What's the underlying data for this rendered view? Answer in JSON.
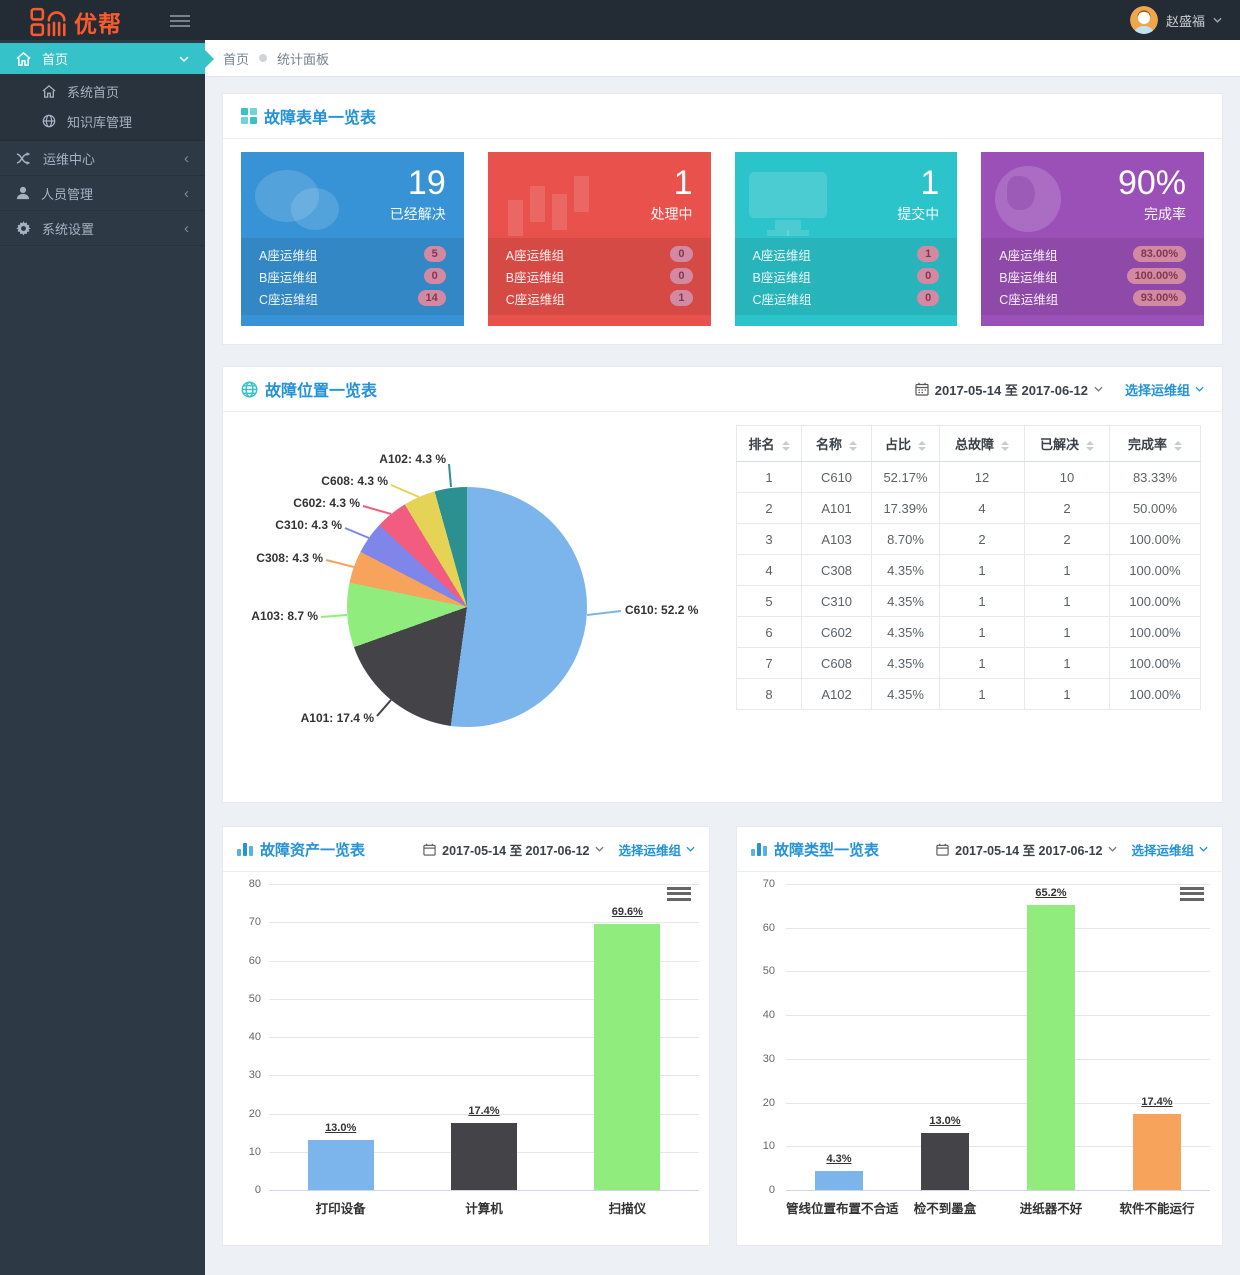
{
  "navbar": {
    "brand": "优帮",
    "user_name": "赵盛福"
  },
  "sidebar": {
    "items": [
      {
        "label": "首页"
      },
      {
        "label": "系统首页"
      },
      {
        "label": "知识库管理"
      },
      {
        "label": "运维中心"
      },
      {
        "label": "人员管理"
      },
      {
        "label": "系统设置"
      }
    ]
  },
  "breadcrumb": {
    "items": [
      "首页",
      "统计面板"
    ]
  },
  "colors": {
    "accent_teal": "#35c2c9",
    "title_blue": "#2492d6",
    "card_blue": "#3793d5",
    "card_red": "#e9514d",
    "card_teal": "#2cc4cb",
    "card_purple": "#9b50b8",
    "badge_pink": "#d389a2"
  },
  "panels": {
    "forms": {
      "title": "故障表单一览表",
      "cards": [
        {
          "value": "19",
          "label": "已经解决",
          "color": "#3793d5",
          "rows": [
            [
              "A座运维组",
              "5"
            ],
            [
              "B座运维组",
              "0"
            ],
            [
              "C座运维组",
              "14"
            ]
          ]
        },
        {
          "value": "1",
          "label": "处理中",
          "color": "#e9514d",
          "rows": [
            [
              "A座运维组",
              "0"
            ],
            [
              "B座运维组",
              "0"
            ],
            [
              "C座运维组",
              "1"
            ]
          ]
        },
        {
          "value": "1",
          "label": "提交中",
          "color": "#2cc4cb",
          "rows": [
            [
              "A座运维组",
              "1"
            ],
            [
              "B座运维组",
              "0"
            ],
            [
              "C座运维组",
              "0"
            ]
          ]
        },
        {
          "value": "90%",
          "label": "完成率",
          "color": "#9b50b8",
          "rows": [
            [
              "A座运维组",
              "83.00%"
            ],
            [
              "B座运维组",
              "100.00%"
            ],
            [
              "C座运维组",
              "93.00%"
            ]
          ]
        }
      ]
    },
    "location": {
      "title": "故障位置一览表",
      "date_range": "2017-05-14 至 2017-06-12",
      "group_select": "选择运维组",
      "table": {
        "headers": [
          "排名",
          "名称",
          "占比",
          "总故障",
          "已解决",
          "完成率"
        ],
        "rows": [
          [
            "1",
            "C610",
            "52.17%",
            "12",
            "10",
            "83.33%"
          ],
          [
            "2",
            "A101",
            "17.39%",
            "4",
            "2",
            "50.00%"
          ],
          [
            "3",
            "A103",
            "8.70%",
            "2",
            "2",
            "100.00%"
          ],
          [
            "4",
            "C308",
            "4.35%",
            "1",
            "1",
            "100.00%"
          ],
          [
            "5",
            "C310",
            "4.35%",
            "1",
            "1",
            "100.00%"
          ],
          [
            "6",
            "C602",
            "4.35%",
            "1",
            "1",
            "100.00%"
          ],
          [
            "7",
            "C608",
            "4.35%",
            "1",
            "1",
            "100.00%"
          ],
          [
            "8",
            "A102",
            "4.35%",
            "1",
            "1",
            "100.00%"
          ]
        ]
      }
    },
    "assets": {
      "title": "故障资产一览表",
      "date_range": "2017-05-14 至 2017-06-12",
      "group_select": "选择运维组"
    },
    "types": {
      "title": "故障类型一览表",
      "date_range": "2017-05-14 至 2017-06-12",
      "group_select": "选择运维组"
    }
  },
  "chart_data": [
    {
      "type": "pie",
      "title": "故障位置一览表",
      "legend_position": "none",
      "points": [
        {
          "name": "C610",
          "value": 52.17,
          "label": "C610: 52.2 %",
          "color": "#7cb5ec"
        },
        {
          "name": "A101",
          "value": 17.39,
          "label": "A101: 17.4 %",
          "color": "#434348"
        },
        {
          "name": "A103",
          "value": 8.7,
          "label": "A103: 8.7 %",
          "color": "#90ed7d"
        },
        {
          "name": "C308",
          "value": 4.35,
          "label": "C308: 4.3 %",
          "color": "#f7a35c"
        },
        {
          "name": "C310",
          "value": 4.35,
          "label": "C310: 4.3 %",
          "color": "#8085e9"
        },
        {
          "name": "C602",
          "value": 4.35,
          "label": "C602: 4.3 %",
          "color": "#f15c80"
        },
        {
          "name": "C608",
          "value": 4.35,
          "label": "C608: 4.3 %",
          "color": "#e4d354"
        },
        {
          "name": "A102",
          "value": 4.35,
          "label": "A102: 4.3 %",
          "color": "#2b908f"
        }
      ]
    },
    {
      "type": "bar",
      "title": "故障资产一览表",
      "categories": [
        "打印设备",
        "计算机",
        "扫描仪"
      ],
      "values": [
        13.0,
        17.4,
        69.6
      ],
      "labels": [
        "13.0%",
        "17.4%",
        "69.6%"
      ],
      "colors": [
        "#7cb5ec",
        "#434348",
        "#90ed7d"
      ],
      "ylim": [
        0,
        80
      ],
      "yticks": [
        0,
        10,
        20,
        30,
        40,
        50,
        60,
        70,
        80
      ],
      "grid": true,
      "xlabel": "",
      "ylabel": ""
    },
    {
      "type": "bar",
      "title": "故障类型一览表",
      "categories": [
        "管线位置布置不合适",
        "检不到墨盒",
        "进纸器不好",
        "软件不能运行"
      ],
      "values": [
        4.3,
        13.0,
        65.2,
        17.4
      ],
      "labels": [
        "4.3%",
        "13.0%",
        "65.2%",
        "17.4%"
      ],
      "colors": [
        "#7cb5ec",
        "#434348",
        "#90ed7d",
        "#f7a35c"
      ],
      "ylim": [
        0,
        70
      ],
      "yticks": [
        0,
        10,
        20,
        30,
        40,
        50,
        60,
        70
      ],
      "grid": true,
      "xlabel": "",
      "ylabel": ""
    }
  ]
}
